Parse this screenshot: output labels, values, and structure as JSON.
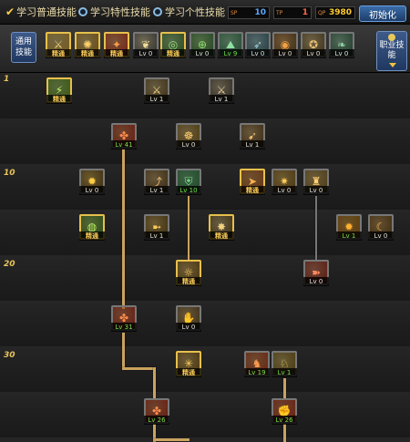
{
  "topbar": {
    "options": [
      {
        "label": "学习普通技能",
        "selected": true
      },
      {
        "label": "学习特性技能",
        "selected": false
      },
      {
        "label": "学习个性技能",
        "selected": false
      }
    ],
    "counters": [
      {
        "tag": "SP",
        "value": "10",
        "color": "#5aa8ff"
      },
      {
        "tag": "TP",
        "value": "1",
        "color": "#ff6a4a"
      },
      {
        "tag": "QP",
        "value": "3980",
        "color": "#ffcc33"
      }
    ],
    "reset_label": "初始化"
  },
  "skillbar": {
    "common_tab": "通用技能",
    "class_tab": "职业技能",
    "slots": [
      {
        "icon": "kick-icon",
        "label": "精通",
        "bg": "#7a5a16",
        "color": "#f0d070"
      },
      {
        "icon": "spin-icon",
        "label": "精通",
        "bg": "#6a4a10",
        "color": "#ffd36a"
      },
      {
        "icon": "fighter-icon",
        "label": "精通",
        "bg": "#7a2010",
        "color": "#ff9a4a"
      },
      {
        "icon": "wings-icon",
        "label": "Lv 0",
        "bg": "#2c2c2c",
        "color": "#eedd99"
      },
      {
        "icon": "target-icon",
        "label": "精通",
        "bg": "#2a4a20",
        "color": "#9adf7a"
      },
      {
        "icon": "crosshair-icon",
        "label": "Lv 0",
        "bg": "#224422",
        "color": "#8fdf6a"
      },
      {
        "icon": "climber-icon",
        "label": "Lv 9",
        "bg": "#204a30",
        "color": "#8fe0a0"
      },
      {
        "icon": "arrow-icon",
        "label": "Lv 0",
        "bg": "#203c40",
        "color": "#9ad0d8"
      },
      {
        "icon": "ring-icon",
        "label": "Lv 0",
        "bg": "#3a2a12",
        "color": "#f0a040"
      },
      {
        "icon": "muscle-icon",
        "label": "Lv 0",
        "bg": "#3a3018",
        "color": "#e8c070"
      },
      {
        "icon": "feather-icon",
        "label": "Lv 0",
        "bg": "#1e3a2a",
        "color": "#8fd0a0"
      }
    ]
  },
  "tree": {
    "levels": [
      "1",
      "10",
      "20",
      "30"
    ],
    "skills": [
      {
        "id": "s1",
        "icon": "slash-icon",
        "label": "精通",
        "style": "m",
        "bg": "#3a5a14",
        "color": "#bff06a"
      },
      {
        "id": "s2",
        "icon": "blade-icon",
        "label": "Lv 1",
        "style": "n",
        "bg": "#3a2e14",
        "color": "#f0d080"
      },
      {
        "id": "s3",
        "icon": "dual-blade-icon",
        "label": "Lv 1",
        "style": "n",
        "bg": "#2e2a20",
        "color": "#e8d0a0"
      },
      {
        "id": "s4",
        "icon": "whirl-icon",
        "label": "Lv 41",
        "style": "g",
        "bg": "#6a1a10",
        "color": "#ff8a4a"
      },
      {
        "id": "s5",
        "icon": "monk-icon",
        "label": "Lv 0",
        "style": "n",
        "bg": "#4a3a10",
        "color": "#ffd070"
      },
      {
        "id": "s6",
        "icon": "leap-icon",
        "label": "Lv 1",
        "style": "n",
        "bg": "#3a2a12",
        "color": "#f0c070"
      },
      {
        "id": "s7",
        "icon": "burst-icon",
        "label": "Lv 0",
        "style": "n",
        "bg": "#3a2a10",
        "color": "#ffcc44"
      },
      {
        "id": "s8",
        "icon": "jump-icon",
        "label": "Lv 1",
        "style": "n",
        "bg": "#3a2a12",
        "color": "#f0c070"
      },
      {
        "id": "s9",
        "icon": "armor-icon",
        "label": "Lv 10",
        "style": "g",
        "bg": "#1e4a2a",
        "color": "#7adf8a"
      },
      {
        "id": "s10",
        "icon": "sprint-icon",
        "label": "精通",
        "style": "m",
        "bg": "#6a3410",
        "color": "#ffb050"
      },
      {
        "id": "s11",
        "icon": "spark-icon",
        "label": "Lv 0",
        "style": "n",
        "bg": "#4a3410",
        "color": "#ffcc55"
      },
      {
        "id": "s12",
        "icon": "stance-icon",
        "label": "Lv 0",
        "style": "n",
        "bg": "#4a3a14",
        "color": "#ffd070"
      },
      {
        "id": "s13",
        "icon": "orb-icon",
        "label": "精通",
        "style": "m",
        "bg": "#2a4a14",
        "color": "#b8f060"
      },
      {
        "id": "s14",
        "icon": "thrust-icon",
        "label": "Lv 1",
        "style": "n",
        "bg": "#3a2c10",
        "color": "#ffcc55"
      },
      {
        "id": "s15",
        "icon": "flurry-icon",
        "label": "精通",
        "style": "m",
        "bg": "#3e3014",
        "color": "#f0d080"
      },
      {
        "id": "s16",
        "icon": "flame-icon",
        "label": "Lv 1",
        "style": "g",
        "bg": "#5a3a0c",
        "color": "#ffb030"
      },
      {
        "id": "s17",
        "icon": "arc-icon",
        "label": "Lv 0",
        "style": "n",
        "bg": "#3a2a10",
        "color": "#f0b050"
      },
      {
        "id": "s18",
        "icon": "aura-icon",
        "label": "精通",
        "style": "m",
        "bg": "#4a3410",
        "color": "#ffd060"
      },
      {
        "id": "s19",
        "icon": "charge-icon",
        "label": "Lv 0",
        "style": "n",
        "bg": "#5a1a10",
        "color": "#ff8a60"
      },
      {
        "id": "s20",
        "icon": "vortex-icon",
        "label": "Lv 31",
        "style": "g",
        "bg": "#6a1a10",
        "color": "#ff8a4a"
      },
      {
        "id": "s21",
        "icon": "grapple-icon",
        "label": "Lv 0",
        "style": "n",
        "bg": "#3a2c14",
        "color": "#f0c070"
      },
      {
        "id": "s22",
        "icon": "nova-icon",
        "label": "精通",
        "style": "m",
        "bg": "#4a3410",
        "color": "#ffd060"
      },
      {
        "id": "s23",
        "icon": "brawler-icon",
        "label": "Lv 19",
        "style": "g",
        "bg": "#6a2410",
        "color": "#ff9a50"
      },
      {
        "id": "s24",
        "icon": "rider-icon",
        "label": "Lv 1",
        "style": "g",
        "bg": "#4a3810",
        "color": "#f0d060"
      },
      {
        "id": "s25",
        "icon": "tornado-icon",
        "label": "Lv 26",
        "style": "g",
        "bg": "#6a1a10",
        "color": "#ff8a4a"
      },
      {
        "id": "s26",
        "icon": "smash-icon",
        "label": "Lv 26",
        "style": "g",
        "bg": "#6a1c10",
        "color": "#ff8a4a"
      }
    ]
  }
}
